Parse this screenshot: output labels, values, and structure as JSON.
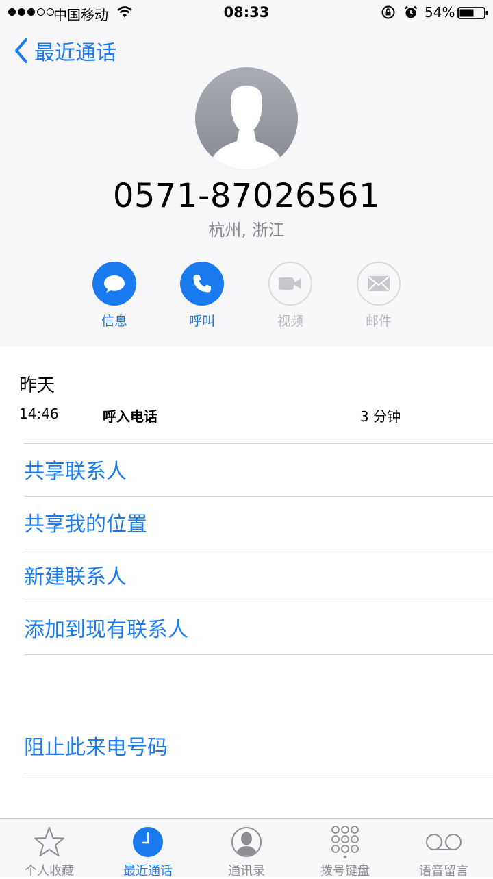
{
  "status_bar": {
    "carrier": "中国移动",
    "time": "08:33",
    "battery": "54%"
  },
  "nav": {
    "back_label": "最近通话"
  },
  "contact": {
    "phone_number": "0571-87026561",
    "location": "杭州, 浙江"
  },
  "actions": [
    {
      "label": "信息",
      "icon": "message-icon",
      "enabled": true
    },
    {
      "label": "呼叫",
      "icon": "phone-icon",
      "enabled": true
    },
    {
      "label": "视频",
      "icon": "video-icon",
      "enabled": false
    },
    {
      "label": "邮件",
      "icon": "mail-icon",
      "enabled": false
    }
  ],
  "call_log": {
    "day": "昨天",
    "entries": [
      {
        "time": "14:46",
        "type": "呼入电话",
        "duration": "3 分钟"
      }
    ]
  },
  "options": [
    {
      "label": "共享联系人"
    },
    {
      "label": "共享我的位置"
    },
    {
      "label": "新建联系人"
    },
    {
      "label": "添加到现有联系人"
    }
  ],
  "block_option": {
    "label": "阻止此来电号码"
  },
  "tabs": [
    {
      "label": "个人收藏",
      "icon": "star-icon",
      "active": false
    },
    {
      "label": "最近通话",
      "icon": "clock-icon",
      "active": true
    },
    {
      "label": "通讯录",
      "icon": "contacts-icon",
      "active": false
    },
    {
      "label": "拨号键盘",
      "icon": "keypad-icon",
      "active": false
    },
    {
      "label": "语音留言",
      "icon": "voicemail-icon",
      "active": false
    }
  ],
  "colors": {
    "accent": "#1a7bf0",
    "disabled": "#b9b9be",
    "secondary_text": "#8a8a8f",
    "header_bg": "#f7f7f9"
  }
}
